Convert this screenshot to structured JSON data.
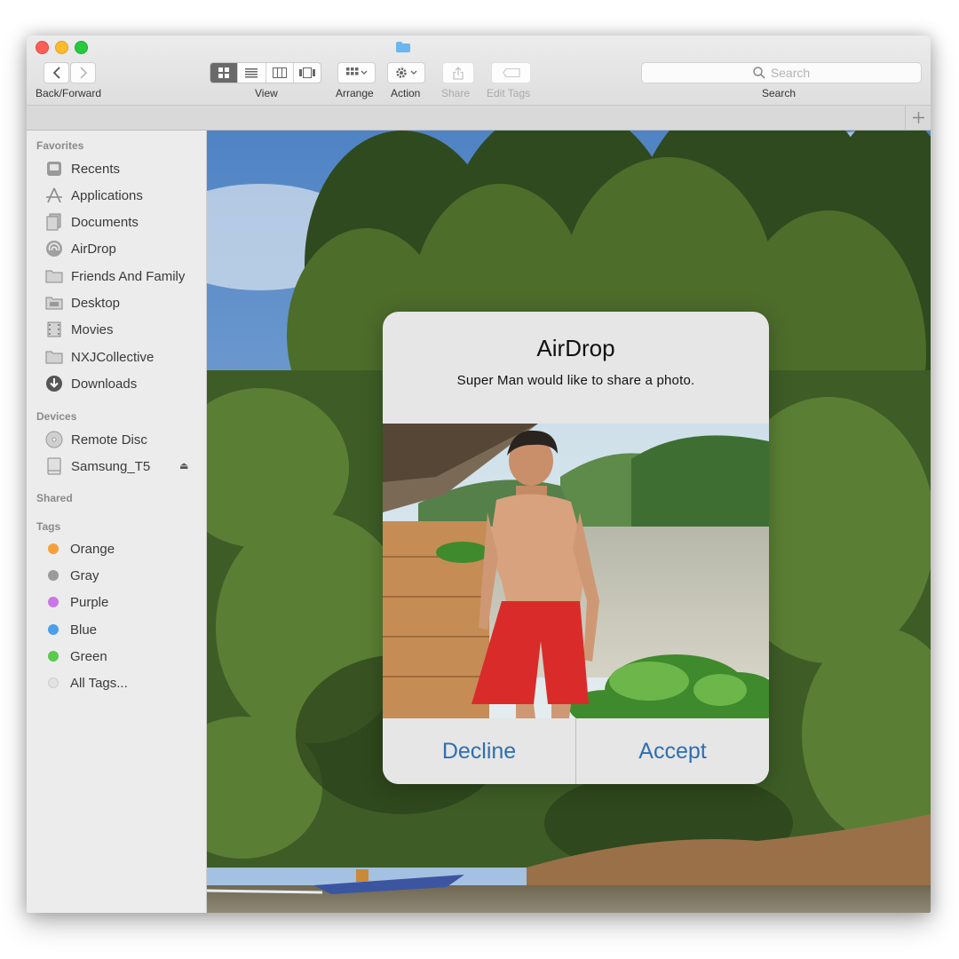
{
  "toolbar": {
    "back_forward_label": "Back/Forward",
    "view_label": "View",
    "arrange_label": "Arrange",
    "action_label": "Action",
    "share_label": "Share",
    "edit_tags_label": "Edit Tags",
    "search_label": "Search",
    "search_placeholder": "Search"
  },
  "sidebar": {
    "favorites_title": "Favorites",
    "favorites": [
      "Recents",
      "Applications",
      "Documents",
      "AirDrop",
      "Friends And Family",
      "Desktop",
      "Movies",
      "NXJCollective",
      "Downloads"
    ],
    "devices_title": "Devices",
    "devices": [
      "Remote Disc",
      "Samsung_T5"
    ],
    "shared_title": "Shared",
    "tags_title": "Tags",
    "tags": [
      {
        "label": "Orange",
        "color": "#f5a13a"
      },
      {
        "label": "Gray",
        "color": "#9b9b9b"
      },
      {
        "label": "Purple",
        "color": "#c977e6"
      },
      {
        "label": "Blue",
        "color": "#4b9fe8"
      },
      {
        "label": "Green",
        "color": "#5bc94c"
      },
      {
        "label": "All Tags...",
        "color": "#e2e2e2"
      }
    ]
  },
  "dialog": {
    "title": "AirDrop",
    "message": "Super Man would like to share a photo.",
    "decline_label": "Decline",
    "accept_label": "Accept",
    "button_color": "#2e6fb0"
  }
}
